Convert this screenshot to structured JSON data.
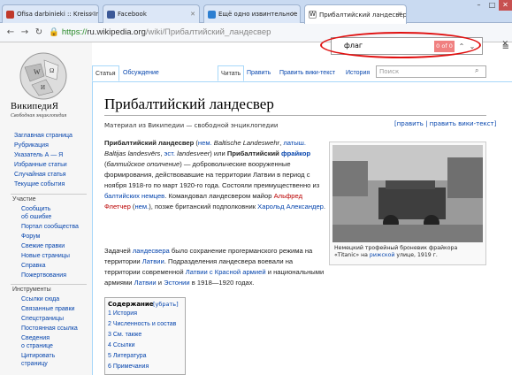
{
  "browser": {
    "tabs": [
      {
        "title": "Ofisa darbinieki :: Kreiss Info",
        "fav_color": "#c0392b"
      },
      {
        "title": "Facebook",
        "fav_color": "#3b5998"
      },
      {
        "title": "Ещё одно извинтельное \"ис",
        "fav_color": "#2d7fd1"
      },
      {
        "title": "Прибалтийский ландесвер",
        "fav_color": "#ffffff"
      }
    ],
    "url_https": "https://",
    "url_host": "ru.wikipedia.org",
    "url_path": "/wiki/Прибалтийский_ландесвер",
    "find": {
      "query": "флаг",
      "count": "0 of 0"
    }
  },
  "sidebar": {
    "wordmark": "ВикипедиЯ",
    "tagline": "Свободная энциклопедия",
    "nav": [
      "Заглавная страница",
      "Рубрикация",
      "Указатель А — Я",
      "Избранные статьи",
      "Случайная статья",
      "Текущие события"
    ],
    "participation_head": "Участие",
    "participation": [
      "Сообщить",
      "об ошибке",
      "Портал сообщества",
      "Форум",
      "Свежие правки",
      "Новые страницы",
      "Справка",
      "Пожертвования"
    ],
    "tools_head": "Инструменты",
    "tools": [
      "Ссылки сюда",
      "Связанные правки",
      "Спецстраницы",
      "Постоянная ссылка",
      "Сведения",
      "о странице",
      "Цитировать",
      "страницу"
    ]
  },
  "tabs": {
    "article": "Статья",
    "talk": "Обсуждение",
    "read": "Читать",
    "edit": "Править",
    "edit_source": "Править вики-текст",
    "history": "История",
    "search_placeholder": "Поиск"
  },
  "article": {
    "title": "Прибалтийский ландесвер",
    "site_sub": "Материал из Википедии — свободной энциклопедии",
    "edit_links": "[править | править вики-текст]",
    "caption_a": "Немецкий трофейный броневик фрайкора «Titanic» на ",
    "caption_link": "рижской",
    "caption_b": " улице, 1919 г.",
    "toc_title": "Содержание",
    "toc_toggle": "[убрать]",
    "toc": [
      "1 История",
      "2 Численность и состав",
      "3 См. также",
      "4 Ссылки",
      "5 Литература",
      "6 Примечания"
    ]
  }
}
